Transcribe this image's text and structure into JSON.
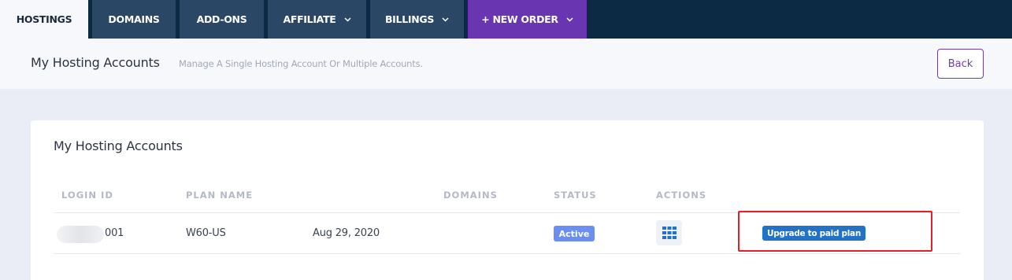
{
  "nav": {
    "tabs": [
      {
        "label": "HOSTINGS"
      },
      {
        "label": "DOMAINS"
      },
      {
        "label": "ADD-ONS"
      },
      {
        "label": "AFFILIATE"
      },
      {
        "label": "BILLINGS"
      },
      {
        "label": "+ NEW ORDER"
      }
    ],
    "colors": {
      "bar": "#0d2a44",
      "tab": "#2a4866",
      "new_order": "#6a35b0"
    }
  },
  "header": {
    "title": "My Hosting Accounts",
    "subtitle": "Manage A Single Hosting Account Or Multiple Accounts.",
    "back_label": "Back"
  },
  "card": {
    "title": "My Hosting Accounts",
    "columns": [
      "LOGIN ID",
      "PLAN NAME",
      "DOMAINS",
      "STATUS",
      "ACTIONS"
    ],
    "rows": [
      {
        "login_id_suffix": "001",
        "plan_name": "W60-US",
        "date": "Aug 29, 2020",
        "status": "Active",
        "actions_icon": "grid-icon",
        "upgrade_label": "Upgrade to paid plan"
      }
    ]
  },
  "colors": {
    "status_active": "#6a8ff0",
    "upgrade_button": "#2272c5",
    "highlight": "#e0202a",
    "accent": "#6b3fa6"
  }
}
